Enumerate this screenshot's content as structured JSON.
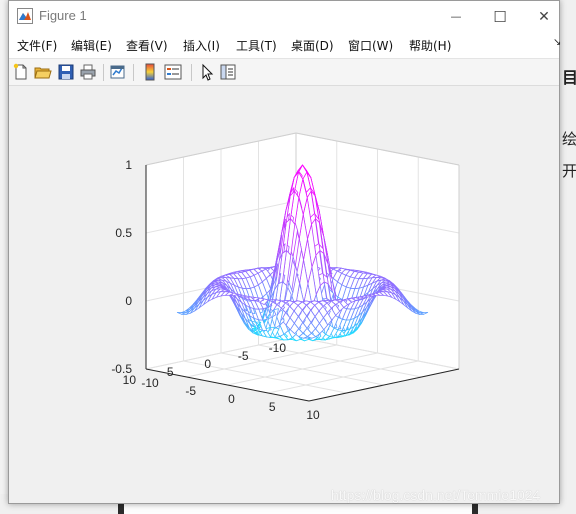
{
  "window": {
    "title": "Figure 1",
    "controls": {
      "minimize": "—",
      "maximize": "☐",
      "close": "✕"
    }
  },
  "menu": {
    "items": [
      "文件(F)",
      "编辑(E)",
      "查看(V)",
      "插入(I)",
      "工具(T)",
      "桌面(D)",
      "窗口(W)",
      "帮助(H)"
    ],
    "overflow_arrow": "↘"
  },
  "toolbar": {
    "icons": [
      "new-figure-icon",
      "open-file-icon",
      "save-icon",
      "print-icon",
      "link-plot-icon",
      "insert-colorbar-icon",
      "insert-legend-icon",
      "edit-plot-icon",
      "property-inspector-icon"
    ]
  },
  "background": {
    "right_fragments": [
      "目",
      "绘",
      "开"
    ]
  },
  "watermark": "https://blog.csdn.net/Temmie1024",
  "chart_data": {
    "type": "mesh",
    "function": "sin(r)/r",
    "x_range": [
      -8,
      8
    ],
    "y_range": [
      -8,
      8
    ],
    "zlim": [
      -0.5,
      1
    ],
    "z_ticks": [
      "1",
      "0.5",
      "0",
      "-0.5"
    ],
    "x_ticks": [
      "-10",
      "-5",
      "0",
      "5",
      "10"
    ],
    "y_ticks": [
      "10",
      "5",
      "0",
      "-5",
      "-10"
    ],
    "colormap": [
      "#00ffff",
      "#ff00ff"
    ],
    "grid": true,
    "title": "",
    "xlabel": "",
    "ylabel": "",
    "zlabel": ""
  }
}
